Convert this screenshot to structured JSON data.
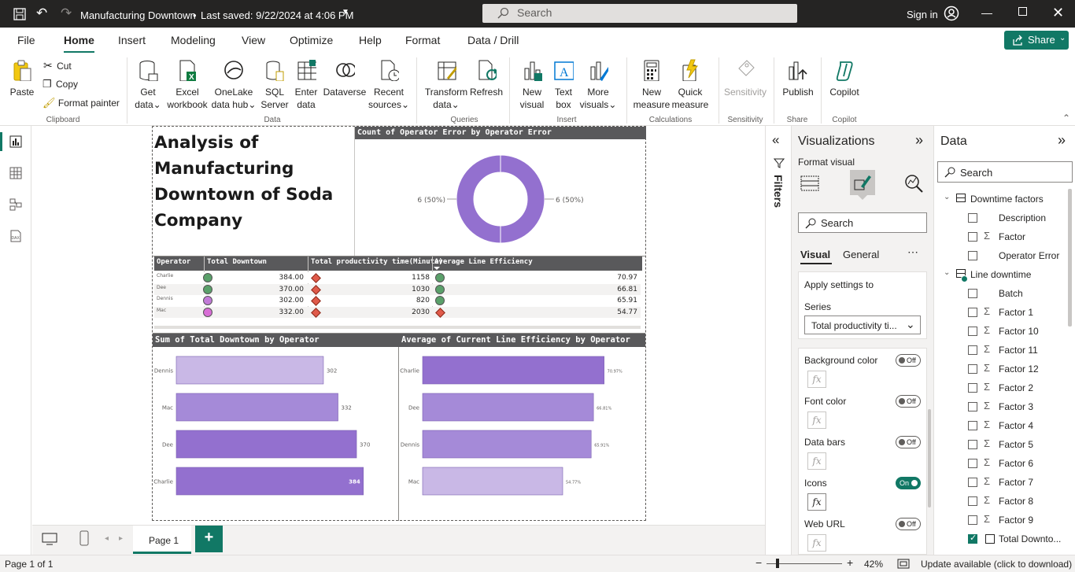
{
  "app": {
    "file_title": "Manufacturing Downtown",
    "saved": "Last saved: 9/22/2024 at 4:06 PM",
    "search_placeholder": "Search",
    "sign_in": "Sign in"
  },
  "menu": {
    "tabs": [
      "File",
      "Home",
      "Insert",
      "Modeling",
      "View",
      "Optimize",
      "Help",
      "Format",
      "Data / Drill"
    ],
    "share": "Share"
  },
  "ribbon": {
    "clipboard": {
      "paste": "Paste",
      "cut": "Cut",
      "copy": "Copy",
      "format_painter": "Format painter",
      "group": "Clipboard"
    },
    "data": {
      "get_data_1": "Get",
      "get_data_2": "data",
      "excel_1": "Excel",
      "excel_2": "workbook",
      "onelake_1": "OneLake",
      "onelake_2": "data hub",
      "sql_1": "SQL",
      "sql_2": "Server",
      "enter_1": "Enter",
      "enter_2": "data",
      "dataverse": "Dataverse",
      "recent_1": "Recent",
      "recent_2": "sources",
      "group": "Data"
    },
    "queries": {
      "transform_1": "Transform",
      "transform_2": "data",
      "refresh": "Refresh",
      "group": "Queries"
    },
    "insert": {
      "new_visual_1": "New",
      "new_visual_2": "visual",
      "text_box_1": "Text",
      "text_box_2": "box",
      "more_1": "More",
      "more_2": "visuals",
      "group": "Insert"
    },
    "calculations": {
      "new_measure_1": "New",
      "new_measure_2": "measure",
      "quick_measure_1": "Quick",
      "quick_measure_2": "measure",
      "group": "Calculations"
    },
    "sensitivity": {
      "label": "Sensitivity",
      "group": "Sensitivity"
    },
    "share": {
      "publish": "Publish",
      "group": "Share"
    },
    "copilot": {
      "label": "Copilot",
      "group": "Copilot"
    }
  },
  "report": {
    "title": "Analysis of Manufacturing Downtown of Soda Company",
    "donut": {
      "header": "Count of Operator Error by Operator Error",
      "left_label": "6 (50%)",
      "right_label": "6 (50%)"
    },
    "matrix": {
      "columns": [
        "Operator",
        "Total Downtown",
        "Total productivity time(Minute)",
        "Average Line Efficiency"
      ],
      "rows": [
        {
          "operator": "Charlie",
          "downtime": "384.00",
          "productivity": "1158",
          "efficiency": "70.97"
        },
        {
          "operator": "Dee",
          "downtime": "370.00",
          "productivity": "1030",
          "efficiency": "66.81"
        },
        {
          "operator": "Dennis",
          "downtime": "302.00",
          "productivity": "820",
          "efficiency": "65.91"
        },
        {
          "operator": "Mac",
          "downtime": "332.00",
          "productivity": "2030",
          "efficiency": "54.77"
        }
      ]
    }
  },
  "chart_data": [
    {
      "type": "pie",
      "title": "Count of Operator Error by Operator Error",
      "labels": [
        "",
        ""
      ],
      "values": [
        6,
        6
      ],
      "data_labels": [
        "6 (50%)",
        "6 (50%)"
      ]
    },
    {
      "type": "bar",
      "orientation": "horizontal",
      "title": "Sum of Total Downtown by Operator",
      "categories": [
        "Dennis",
        "Mac",
        "Dee",
        "Charlie"
      ],
      "values": [
        302,
        332,
        370,
        384
      ],
      "data_labels": [
        "302",
        "332",
        "370",
        "384"
      ],
      "xlim": [
        0,
        420
      ]
    },
    {
      "type": "bar",
      "orientation": "horizontal",
      "title": "Average of Current Line Efficiency by Operator",
      "categories": [
        "Charlie",
        "Dee",
        "Dennis",
        "Mac"
      ],
      "values": [
        70.97,
        66.81,
        65.91,
        54.77
      ],
      "data_labels": [
        "70.97%",
        "66.81%",
        "65.91%",
        "54.77%"
      ],
      "xlim": [
        0,
        80
      ]
    }
  ],
  "filters": {
    "label": "Filters"
  },
  "viz": {
    "title": "Visualizations",
    "format_visual": "Format visual",
    "search": "Search",
    "tab_visual": "Visual",
    "tab_general": "General",
    "apply_settings": "Apply settings to",
    "series_label": "Series",
    "series_value": "Total productivity ti...",
    "options": [
      {
        "label": "Background color",
        "state": "Off"
      },
      {
        "label": "Font color",
        "state": "Off"
      },
      {
        "label": "Data bars",
        "state": "Off"
      },
      {
        "label": "Icons",
        "state": "On"
      },
      {
        "label": "Web URL",
        "state": "Off"
      }
    ],
    "fx": "fx"
  },
  "data_pane": {
    "title": "Data",
    "search": "Search",
    "tables": [
      {
        "name": "Downtime factors",
        "fields": [
          {
            "name": "Description",
            "sigma": false,
            "checked": false
          },
          {
            "name": "Factor",
            "sigma": true,
            "checked": false
          },
          {
            "name": "Operator Error",
            "sigma": false,
            "checked": false
          }
        ]
      },
      {
        "name": "Line downtime",
        "fields": [
          {
            "name": "Batch",
            "sigma": false,
            "checked": false
          },
          {
            "name": "Factor 1",
            "sigma": true,
            "checked": false
          },
          {
            "name": "Factor 10",
            "sigma": true,
            "checked": false
          },
          {
            "name": "Factor 11",
            "sigma": true,
            "checked": false
          },
          {
            "name": "Factor 12",
            "sigma": true,
            "checked": false
          },
          {
            "name": "Factor 2",
            "sigma": true,
            "checked": false
          },
          {
            "name": "Factor 3",
            "sigma": true,
            "checked": false
          },
          {
            "name": "Factor 4",
            "sigma": true,
            "checked": false
          },
          {
            "name": "Factor 5",
            "sigma": true,
            "checked": false
          },
          {
            "name": "Factor 6",
            "sigma": true,
            "checked": false
          },
          {
            "name": "Factor 7",
            "sigma": true,
            "checked": false
          },
          {
            "name": "Factor 8",
            "sigma": true,
            "checked": false
          },
          {
            "name": "Factor 9",
            "sigma": true,
            "checked": false
          },
          {
            "name": "Total Downto...",
            "sigma": false,
            "checked": true
          }
        ]
      }
    ]
  },
  "bottom": {
    "page_tab": "Page 1",
    "add": "+"
  },
  "status": {
    "page": "Page 1 of 1",
    "zoom": "42%",
    "update": "Update available (click to download)"
  },
  "colors": {
    "accent": "#117865",
    "purple_dark": "#9370cf",
    "purple_mid": "#a58ad8",
    "purple_light": "#c9b8e6",
    "header_gray": "#59595b"
  }
}
